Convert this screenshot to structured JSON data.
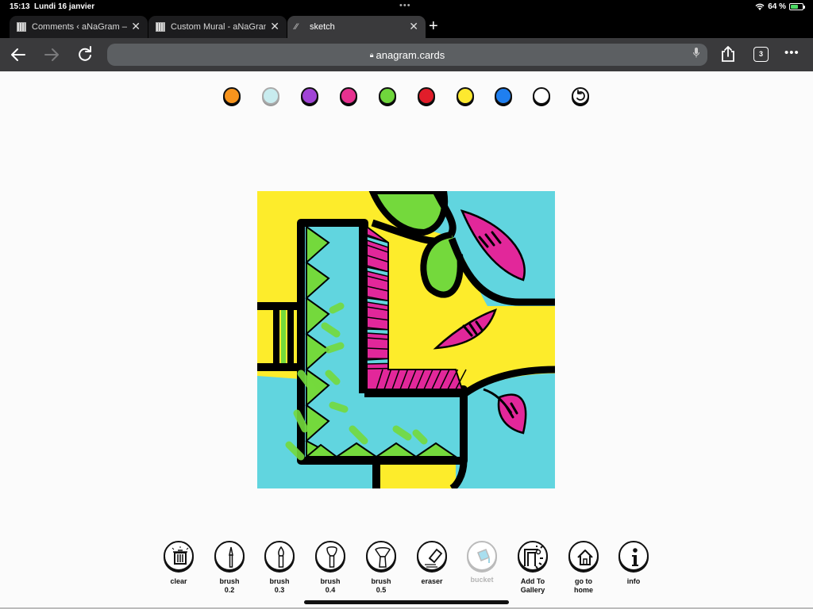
{
  "status_bar": {
    "time": "15:13",
    "date": "Lundi 16 janvier",
    "battery_percent_label": "64 %",
    "battery_level": 0.64,
    "charging": true
  },
  "tabs": [
    {
      "title": "Comments ‹ aNaGram —",
      "active": false
    },
    {
      "title": "Custom Mural - aNaGram",
      "active": false
    },
    {
      "title": "sketch",
      "active": true
    }
  ],
  "toolbar": {
    "url": "anagram.cards",
    "tab_count": "3"
  },
  "palette": {
    "colors": [
      {
        "name": "orange",
        "hex": "#f7941d"
      },
      {
        "name": "light-cyan",
        "hex": "#c8ecef"
      },
      {
        "name": "purple",
        "hex": "#a144d6"
      },
      {
        "name": "pink",
        "hex": "#e6318f"
      },
      {
        "name": "green",
        "hex": "#6fd63c"
      },
      {
        "name": "red",
        "hex": "#e11d2a"
      },
      {
        "name": "yellow",
        "hex": "#fde92f"
      },
      {
        "name": "blue",
        "hex": "#1f7ff0"
      },
      {
        "name": "white",
        "hex": "#ffffff"
      }
    ],
    "undo_label": "undo"
  },
  "artwork": {
    "colors": {
      "yellow": "#fdec2b",
      "cyan": "#61d5df",
      "green": "#74d93c",
      "pink": "#e2279a",
      "black": "#000000",
      "white": "#ffffff"
    }
  },
  "tools": [
    {
      "id": "clear",
      "label": "clear",
      "enabled": true
    },
    {
      "id": "brush-02",
      "label": "brush 0.2",
      "line1": "brush",
      "line2": "0.2",
      "enabled": true
    },
    {
      "id": "brush-03",
      "label": "brush 0.3",
      "line1": "brush",
      "line2": "0.3",
      "enabled": true
    },
    {
      "id": "brush-04",
      "label": "brush 0.4",
      "line1": "brush",
      "line2": "0.4",
      "enabled": true
    },
    {
      "id": "brush-05",
      "label": "brush 0.5",
      "line1": "brush",
      "line2": "0.5",
      "enabled": true
    },
    {
      "id": "eraser",
      "label": "eraser",
      "enabled": true
    },
    {
      "id": "bucket",
      "label": "bucket",
      "enabled": false
    },
    {
      "id": "add-to-gallery",
      "line1": "Add To",
      "line2": "Gallery",
      "enabled": true
    },
    {
      "id": "go-to-home",
      "line1": "go to",
      "line2": "home",
      "enabled": true
    },
    {
      "id": "info",
      "label": "info",
      "enabled": true
    }
  ]
}
